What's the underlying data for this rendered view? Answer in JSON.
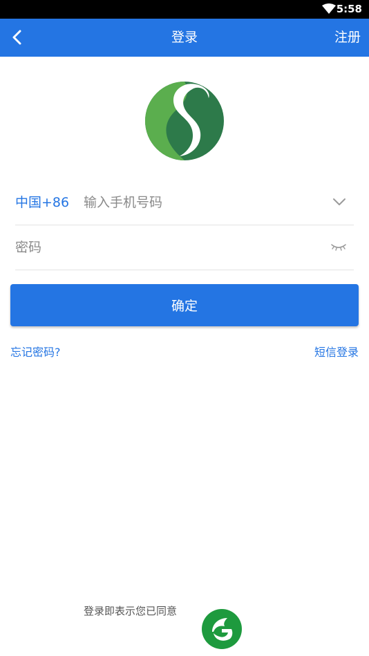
{
  "status_bar": {
    "time": "5:58"
  },
  "header": {
    "title": "登录",
    "register_label": "注册"
  },
  "form": {
    "country_code": "中国+86",
    "phone_placeholder": "输入手机号码",
    "password_placeholder": "密码",
    "confirm_label": "确定"
  },
  "links": {
    "forgot_password": "忘记密码?",
    "sms_login": "短信登录"
  },
  "footer": {
    "agreement_text": "登录即表示您已同意"
  },
  "colors": {
    "primary": "#2475E3",
    "logo_dark_green": "#2D7A4A",
    "logo_light_green": "#5BAE4E"
  },
  "icons": {
    "back": "chevron-left-icon",
    "wifi": "wifi-icon",
    "dropdown": "chevron-down-icon",
    "password_visibility": "eye-closed-icon"
  }
}
